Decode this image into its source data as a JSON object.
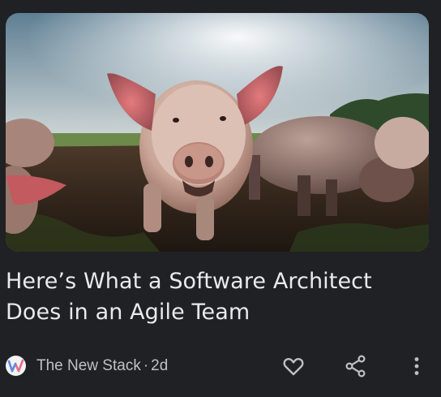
{
  "article": {
    "headline_line1": "Here’s What a Software Architect",
    "headline_line2": "Does in an Agile Team",
    "image_alt": "pig",
    "source": {
      "logo_letter": "W",
      "name": "The New Stack",
      "separator": "·",
      "age": "2d"
    }
  },
  "actions": {
    "like_icon": "heart-outline-icon",
    "share_icon": "share-icon",
    "more_icon": "more-vert-icon"
  },
  "colors": {
    "background": "#202124",
    "headline": "#e8eaed",
    "meta_text": "#bdc1c6",
    "icon": "#bdc1c6",
    "logo_accent": "#7b61c9"
  }
}
